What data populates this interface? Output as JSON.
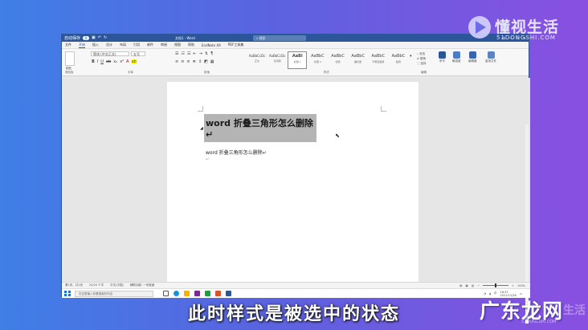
{
  "window": {
    "autosave": "自动保存",
    "autosave_state": "关",
    "doc_title": "文档1 - Word",
    "search_placeholder": "搜索",
    "user": "ck"
  },
  "menu": [
    "文件",
    "开始",
    "插入",
    "设计",
    "布局",
    "引用",
    "邮件",
    "审阅",
    "视图",
    "帮助",
    "EndNote X9",
    "PDF工具集"
  ],
  "active_menu": "开始",
  "ribbon": {
    "paste_label": "粘贴",
    "font_name": "等线 (中文正文)",
    "font_size": "五号",
    "groups": [
      "剪贴板",
      "字体",
      "段落",
      "样式",
      "编辑",
      "语音",
      "敏感度",
      "编辑器",
      "重用文件"
    ],
    "styles": [
      {
        "sample": "AaBbCcDc",
        "name": "正文"
      },
      {
        "sample": "AaBbCcDc",
        "name": "无间隔"
      },
      {
        "sample": "AaBl",
        "name": "标题 1"
      },
      {
        "sample": "AaBbC",
        "name": "标题 2"
      },
      {
        "sample": "AaBbC",
        "name": "标题"
      },
      {
        "sample": "AaBbC",
        "name": "副标题"
      },
      {
        "sample": "AaBbC",
        "name": "不明显强调"
      },
      {
        "sample": "AaBbC",
        "name": "强调"
      }
    ],
    "selected_style": "标题 1",
    "find": "查找",
    "replace": "替换",
    "select": "选择",
    "dictate": "听写",
    "sensitivity": "敏感度",
    "editor": "编辑器",
    "reuse": "重用文件"
  },
  "document": {
    "heading": "word 折叠三角形怎么删除↵",
    "body": "word 折叠三角形怎么删除↵",
    "para_mark": "↵"
  },
  "status": {
    "page": "第1页，共1页",
    "words": "20/20 个字",
    "lang": "中文(中国)",
    "accessibility": "辅助功能: 一切就绪",
    "zoom": "100%"
  },
  "taskbar": {
    "search_placeholder": "在这里输入你要搜索的内容",
    "time": "16:31",
    "date": "2021/11/26",
    "ime": "中"
  },
  "overlay": {
    "logo_top_name": "懂视生活",
    "logo_top_url": "51DONGSHI.COM",
    "caption": "此时样式是被选中的状态",
    "logo_bottom_name": "广东龙网",
    "logo_bottom_watermark": "生活",
    "logo_bottom_url": "51DONGSHI.COM"
  },
  "colors": {
    "word_blue": "#2b579a",
    "selection_gray": "#b4b4b4"
  }
}
